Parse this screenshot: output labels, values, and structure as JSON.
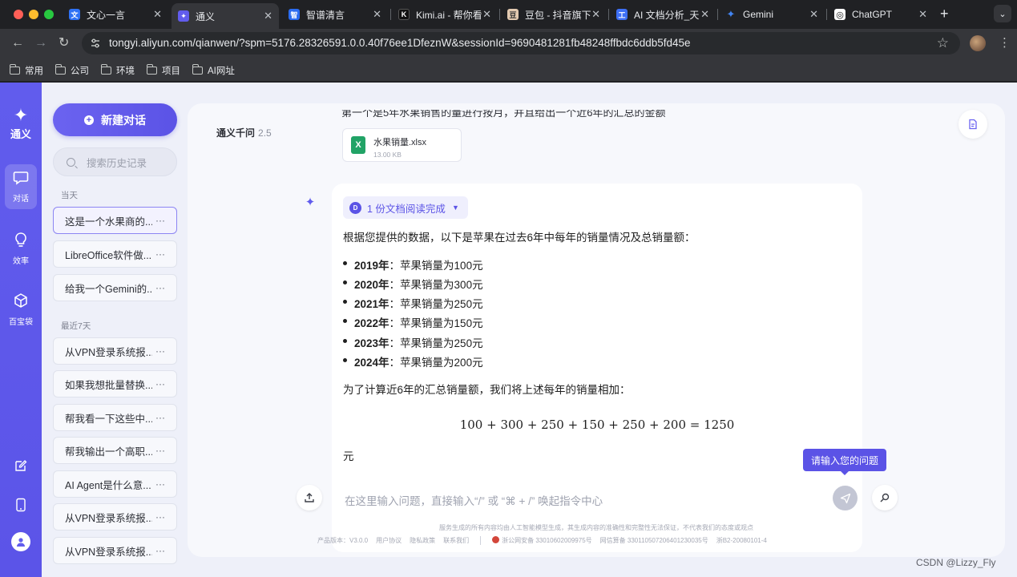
{
  "browser": {
    "tabs": [
      {
        "title": "文心一言",
        "fav_color": "#2f72f5",
        "fav": "文"
      },
      {
        "title": "通义",
        "fav_color": "#615ced",
        "fav": "✦"
      },
      {
        "title": "智谱清言",
        "fav_color": "#2b6cf0",
        "fav": "智"
      },
      {
        "title": "Kimi.ai - 帮你看",
        "fav_color": "#111111",
        "fav": "K"
      },
      {
        "title": "豆包 - 抖音旗下",
        "fav_color": "#e2c9b0",
        "fav": "豆"
      },
      {
        "title": "AI 文档分析_天",
        "fav_color": "#3d6ff5",
        "fav": "工"
      },
      {
        "title": "Gemini",
        "fav_color": "#4285f4",
        "fav": "✦"
      },
      {
        "title": "ChatGPT",
        "fav_color": "#ffffff",
        "fav": "◎"
      }
    ],
    "url": "tongyi.aliyun.com/qianwen/?spm=5176.28326591.0.0.40f76ee1DfeznW&sessionId=9690481281fb48248ffbdc6ddb5fd45e",
    "bookmarks": [
      "常用",
      "公司",
      "环境",
      "项目",
      "AI网址"
    ]
  },
  "rail": {
    "brand": "通义",
    "items": [
      {
        "label": "对话",
        "icon": "chat-icon"
      },
      {
        "label": "效率",
        "icon": "lightbulb-icon"
      },
      {
        "label": "百宝袋",
        "icon": "cube-icon"
      }
    ]
  },
  "sidebar": {
    "new_chat": "新建对话",
    "search_placeholder": "搜索历史记录",
    "group_today": "当天",
    "group_week": "最近7天",
    "today": [
      "这是一个水果商的...",
      "LibreOffice软件做....",
      "给我一个Gemini的..."
    ],
    "week": [
      "从VPN登录系统报...",
      "如果我想批量替换...",
      "帮我看一下这些中...",
      "帮我输出一个高职...",
      "AI Agent是什么意...",
      "从VPN登录系统报...",
      "从VPN登录系统报..."
    ],
    "more": "···"
  },
  "main": {
    "model": "通义千问",
    "version": "2.5",
    "prev_line": "第一个是5年水果销售的量进行按月，并且给出一个近6年的汇总的金额",
    "file": {
      "name": "水果销量.xlsx",
      "size": "13.00 KB",
      "icon": "X"
    },
    "read_pill": "1 份文档阅读完成",
    "read_pill_icon": "D",
    "intro": "根据您提供的数据，以下是苹果在过去6年中每年的销量情况及总销量额：",
    "rows": [
      {
        "year": "2019年",
        "text": "：苹果销量为100元"
      },
      {
        "year": "2020年",
        "text": "：苹果销量为300元"
      },
      {
        "year": "2021年",
        "text": "：苹果销量为250元"
      },
      {
        "year": "2022年",
        "text": "：苹果销量为150元"
      },
      {
        "year": "2023年",
        "text": "：苹果销量为250元"
      },
      {
        "year": "2024年",
        "text": "：苹果销量为200元"
      }
    ],
    "sum_intro": "为了计算近6年的汇总销量额，我们将上述每年的销量相加：",
    "formula": "100 + 300 + 250 + 150 + 250 + 200 = 1250",
    "unit": "元",
    "tooltip": "请输入您的问题",
    "input_placeholder": "在这里输入问题，直接输入“/” 或 “⌘ + /” 唤起指令中心",
    "disclaimer": "服务生成的所有内容均由人工智能模型生成，其生成内容的准确性和完整性无法保证，不代表我们的态度或观点",
    "footer": {
      "version": "产品版本：V3.0.0",
      "agreement": "用户协议",
      "privacy": "隐私政策",
      "contact": "联系我们",
      "police": "浙公网安备 33010602009975号",
      "icp": "网信算备 330110507206401230035号",
      "icp2": "浙B2-20080101-4"
    }
  },
  "watermark": "CSDN @Lizzy_Fly"
}
